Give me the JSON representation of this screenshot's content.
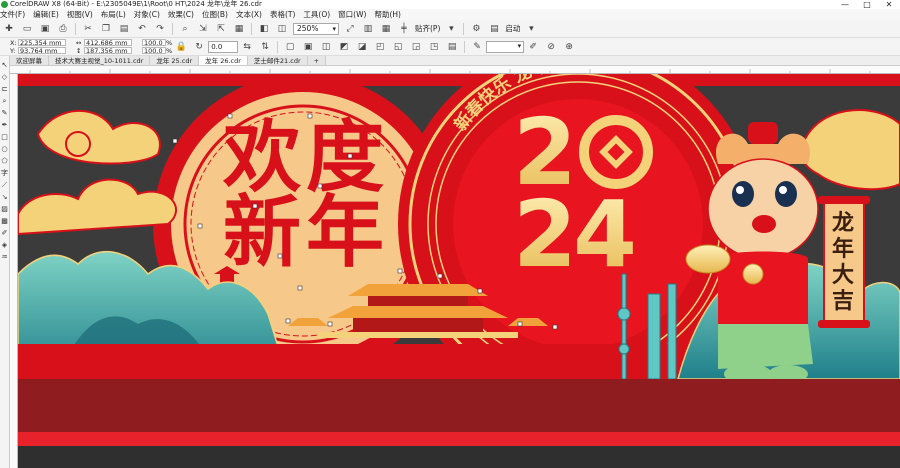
{
  "titlebar": {
    "title": "CorelDRAW X8 (64-Bit) - E:\\2305049E\\1\\Root\\0 HT\\2024 龙年\\龙年 26.cdr",
    "controls": [
      "—",
      "□",
      "✕"
    ]
  },
  "menu": [
    "文件(F)",
    "编辑(E)",
    "视图(V)",
    "布局(L)",
    "对象(C)",
    "效果(C)",
    "位图(B)",
    "文本(X)",
    "表格(T)",
    "工具(O)",
    "窗口(W)",
    "帮助(H)"
  ],
  "toolbar": {
    "zoom": "250%",
    "snap_label": "贴齐(P)",
    "launch_label": "启动"
  },
  "propbar": {
    "x": "225.354 mm",
    "y": "93.764 mm",
    "w": "412.686 mm",
    "h": "187.356 mm",
    "sx": "100.0",
    "sy": "100.0",
    "pct": "%",
    "angle": "0.0"
  },
  "tabs": [
    {
      "label": "欢迎屏幕",
      "active": false
    },
    {
      "label": "技术大赛主视觉_10-1011.cdr",
      "active": false
    },
    {
      "label": "龙年 25.cdr",
      "active": false
    },
    {
      "label": "龙年 26.cdr",
      "active": true
    },
    {
      "label": "芝士邮件21.cdr",
      "active": false
    }
  ],
  "artwork": {
    "headline_chars": [
      "欢",
      "度",
      "新",
      "年"
    ],
    "year_digits": [
      "2",
      "2",
      "4"
    ],
    "arc_text": "新春快乐 龙年大吉",
    "scroll_text": [
      "龙",
      "年",
      "大",
      "吉"
    ],
    "colors": {
      "red": "#d8101a",
      "dark_red": "#8f1c1e",
      "gold": "#f4d27a",
      "cream": "#f6c98a",
      "teal": "#2ea8a6",
      "sky": "#ececec"
    }
  }
}
